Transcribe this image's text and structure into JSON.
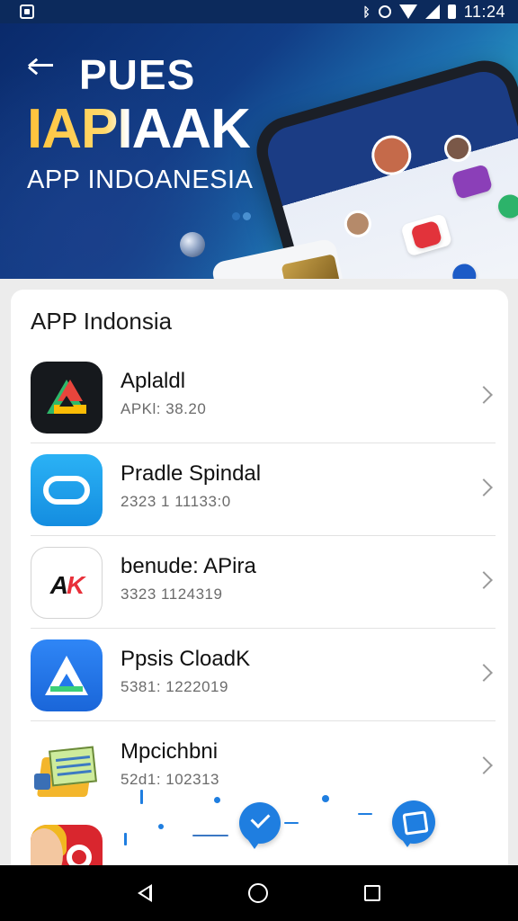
{
  "status_bar": {
    "time": "11:24",
    "icons": [
      "notification-icon",
      "bluetooth-icon",
      "alarm-icon",
      "wifi-icon",
      "signal-icon",
      "battery-icon"
    ]
  },
  "hero": {
    "title_line1": "PUES",
    "title_line2": "IAPIAAK",
    "subtitle": "APP INDOANESIA"
  },
  "list": {
    "title": "APP Indonsia",
    "items": [
      {
        "name": "Aplaldl",
        "meta": "APKl: 38.20",
        "icon": "drive-icon"
      },
      {
        "name": "Pradle Spindal",
        "meta": "2323 1 11133:0",
        "icon": "cloud-icon"
      },
      {
        "name": "benude: APira",
        "meta": "3323 1124319",
        "icon": "ak-logo-icon"
      },
      {
        "name": "Ppsis CloadK",
        "meta": "5381: 1222019",
        "icon": "a-logo-icon"
      },
      {
        "name": "Mpcichbni",
        "meta": "52d1: 102313",
        "icon": "folder-icon"
      },
      {
        "name": "",
        "meta": "",
        "icon": "search-icon"
      }
    ]
  },
  "colors": {
    "hero_dark": "#0a2a6b",
    "accent_blue": "#1f7ee0",
    "title_gold": "#ffc23a"
  }
}
